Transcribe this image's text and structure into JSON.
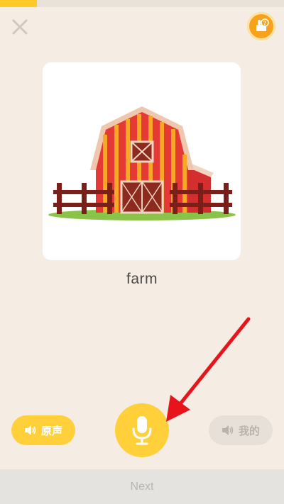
{
  "progress": {
    "fraction": 0.13,
    "color": "#ffc928"
  },
  "header": {
    "close_icon": "close-icon",
    "help_icon": "hand-question-icon"
  },
  "card": {
    "image": "barn-illustration",
    "word": "farm"
  },
  "controls": {
    "original_label": "原声",
    "mine_label": "我的",
    "mic_icon": "microphone-icon",
    "accent": "#ffd03a"
  },
  "footer": {
    "next_label": "Next"
  },
  "annotation": {
    "arrow_color": "#e8141b"
  }
}
